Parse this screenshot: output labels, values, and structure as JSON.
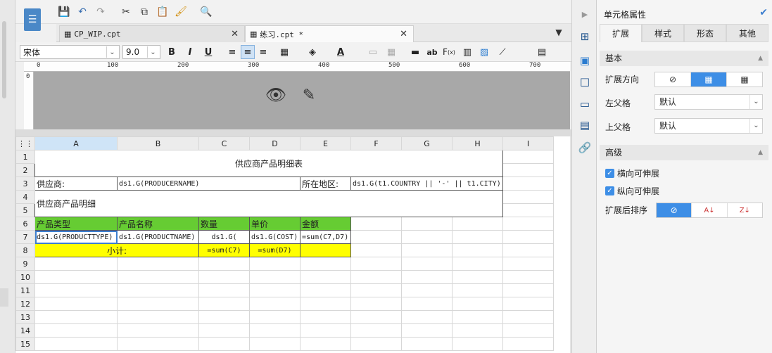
{
  "tabs": [
    {
      "label": "CP_WIP.cpt",
      "active": false
    },
    {
      "label": "练习.cpt *",
      "active": true
    }
  ],
  "format": {
    "font_name": "宋体",
    "font_size": "9.0",
    "bold": "B",
    "italic": "I",
    "underline": "U"
  },
  "ruler": {
    "labels": [
      "0",
      "100",
      "200",
      "300",
      "400",
      "500",
      "600",
      "700"
    ],
    "vertical_label": "0"
  },
  "grid": {
    "columns": [
      "A",
      "B",
      "C",
      "D",
      "E",
      "F",
      "G",
      "H",
      "I"
    ],
    "rows": [
      "1",
      "2",
      "3",
      "4",
      "5",
      "6",
      "7",
      "8",
      "9",
      "10",
      "11",
      "12",
      "13",
      "14",
      "15"
    ],
    "title": "供应商产品明细表",
    "supplier_label": "供应商:",
    "supplier_value": "ds1.G(PRODUCERNAME)",
    "region_label": "所在地区:",
    "region_value": "ds1.G(t1.COUNTRY || '-' || t1.CITY)",
    "detail_label": "供应商产品明细",
    "headers": [
      "产品类型",
      "产品名称",
      "数量",
      "单价",
      "金额"
    ],
    "data_row": [
      "ds1.G(PRODUCTTYPE)",
      "ds1.G(PRODUCTNAME)",
      "ds1.G(",
      "ds1.G(COST)",
      "=sum(C7,D7)"
    ],
    "subtotal_label": "小计:",
    "subtotal_c": "=sum(C7)",
    "subtotal_d": "=sum(D7)"
  },
  "panel": {
    "title": "单元格属性",
    "tabs": [
      "扩展",
      "样式",
      "形态",
      "其他"
    ],
    "section_basic": "基本",
    "expand_direction_label": "扩展方向",
    "left_parent_label": "左父格",
    "left_parent_value": "默认",
    "top_parent_label": "上父格",
    "top_parent_value": "默认",
    "section_advanced": "高级",
    "horizontal_extend": "横向可伸展",
    "vertical_extend": "纵向可伸展",
    "sort_after_label": "扩展后排序"
  },
  "colors": {
    "header_green": "#66cc33",
    "subtotal_yellow": "#ffff00",
    "accent_blue": "#3d8ee6"
  }
}
